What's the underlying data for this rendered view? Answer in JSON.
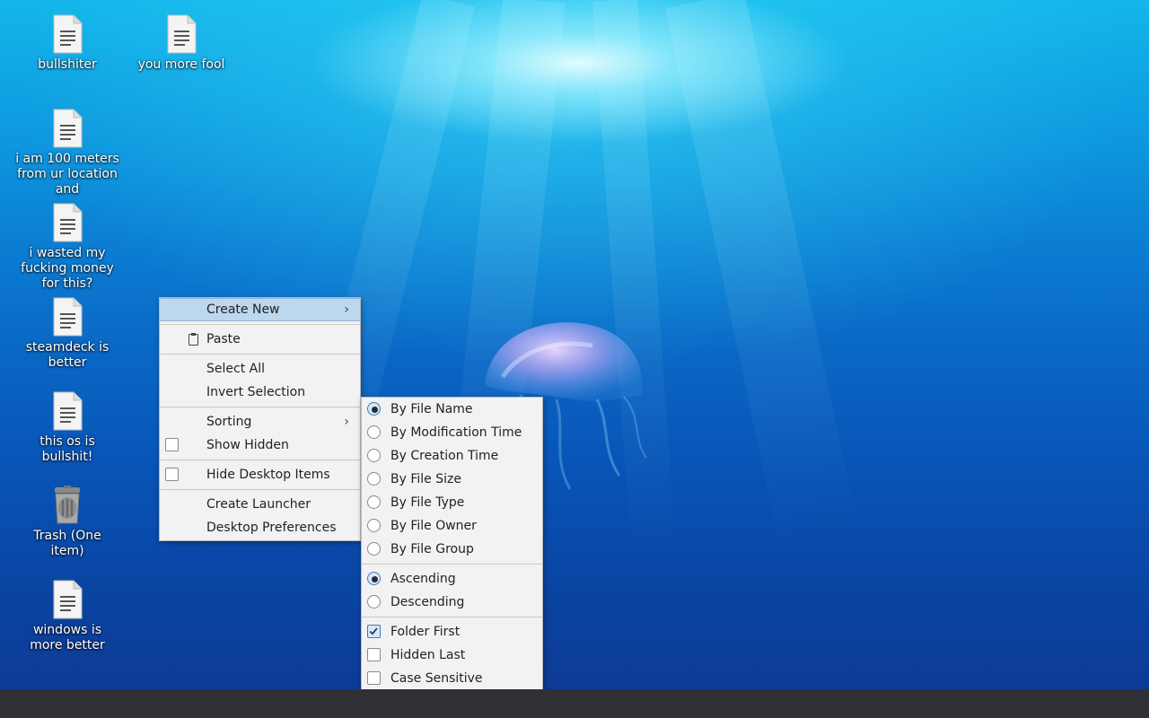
{
  "desktop": {
    "icons": [
      {
        "label": "bullshiter",
        "type": "text-file-icon"
      },
      {
        "label": "you more fool",
        "type": "text-file-icon"
      },
      {
        "label": "i am 100 meters from ur location and",
        "type": "text-file-icon"
      },
      {
        "label": "i wasted my fucking money for this?",
        "type": "text-file-icon"
      },
      {
        "label": "steamdeck is better",
        "type": "text-file-icon"
      },
      {
        "label": "this os is bullshit!",
        "type": "text-file-icon"
      },
      {
        "label": "Trash (One item)",
        "type": "trash-icon"
      },
      {
        "label": "windows is more better",
        "type": "text-file-icon"
      }
    ]
  },
  "context_menu": {
    "create_new": "Create New",
    "paste": "Paste",
    "select_all": "Select All",
    "invert_selection": "Invert Selection",
    "sorting": "Sorting",
    "show_hidden": "Show Hidden",
    "hide_desktop_items": "Hide Desktop Items",
    "create_launcher": "Create Launcher",
    "desktop_preferences": "Desktop Preferences",
    "show_hidden_checked": false,
    "hide_desktop_items_checked": false,
    "highlighted_item": "Create New"
  },
  "sorting_menu": {
    "sort_by": [
      {
        "label": "By File Name",
        "checked": true
      },
      {
        "label": "By Modification Time",
        "checked": false
      },
      {
        "label": "By Creation Time",
        "checked": false
      },
      {
        "label": "By File Size",
        "checked": false
      },
      {
        "label": "By File Type",
        "checked": false
      },
      {
        "label": "By File Owner",
        "checked": false
      },
      {
        "label": "By File Group",
        "checked": false
      }
    ],
    "order": [
      {
        "label": "Ascending",
        "checked": true
      },
      {
        "label": "Descending",
        "checked": false
      }
    ],
    "options": [
      {
        "label": "Folder First",
        "checked": true
      },
      {
        "label": "Hidden Last",
        "checked": false
      },
      {
        "label": "Case Sensitive",
        "checked": false
      }
    ]
  },
  "colors": {
    "menu_highlight": "#bcd7ee",
    "taskbar": "#2f3136",
    "water_top": "#13b6ea",
    "water_bottom": "#0d3b96"
  }
}
